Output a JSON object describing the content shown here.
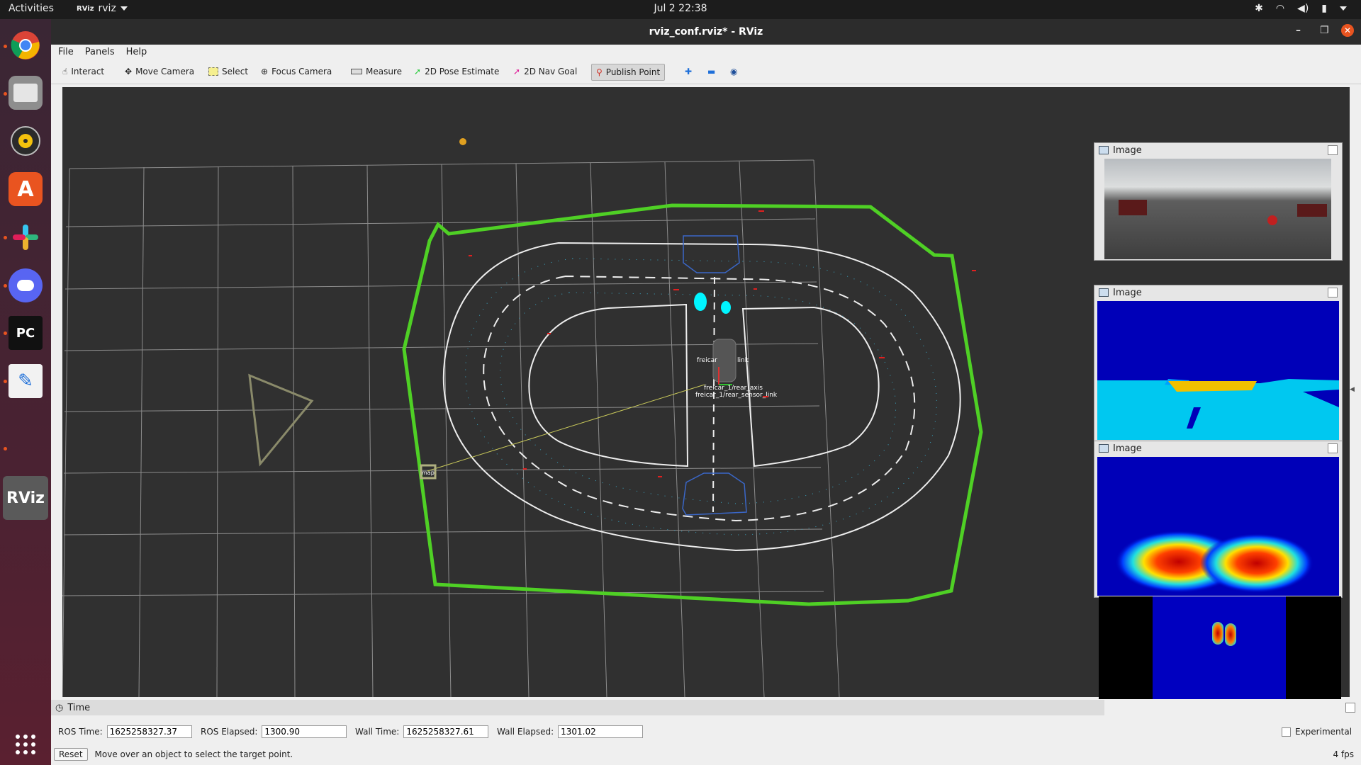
{
  "topbar": {
    "activities": "Activities",
    "app_name": "rviz",
    "clock": "Jul 2  22:38"
  },
  "window": {
    "title": "rviz_conf.rviz* - RViz"
  },
  "menu": [
    "File",
    "Panels",
    "Help"
  ],
  "toolbar": {
    "interact": "Interact",
    "move_camera": "Move Camera",
    "select": "Select",
    "focus_camera": "Focus Camera",
    "measure": "Measure",
    "pose_estimate": "2D Pose Estimate",
    "nav_goal": "2D Nav Goal",
    "publish_point": "Publish Point"
  },
  "image_panels": [
    "Image",
    "Image",
    "Image"
  ],
  "time": {
    "panel_title": "Time",
    "ros_time_label": "ROS Time:",
    "ros_time": "1625258327.37",
    "ros_elapsed_label": "ROS Elapsed:",
    "ros_elapsed": "1300.90",
    "wall_time_label": "Wall Time:",
    "wall_time": "1625258327.61",
    "wall_elapsed_label": "Wall Elapsed:",
    "wall_elapsed": "1301.02",
    "experimental": "Experimental"
  },
  "status": {
    "reset": "Reset",
    "message": "Move over an object to select the target point.",
    "fps": "4 fps"
  },
  "frames": {
    "map": "map",
    "base_link": "freicar_1/base_link",
    "sensor_link": "freicar_1/rear_axis",
    "lidar": "freicar_1/rear_sensor_link",
    "label_a": "freicar",
    "label_b": "link"
  },
  "colors": {
    "accent": "#e95420",
    "green_boundary": "#4fd025",
    "ground_grid": "#9a9a9a"
  }
}
